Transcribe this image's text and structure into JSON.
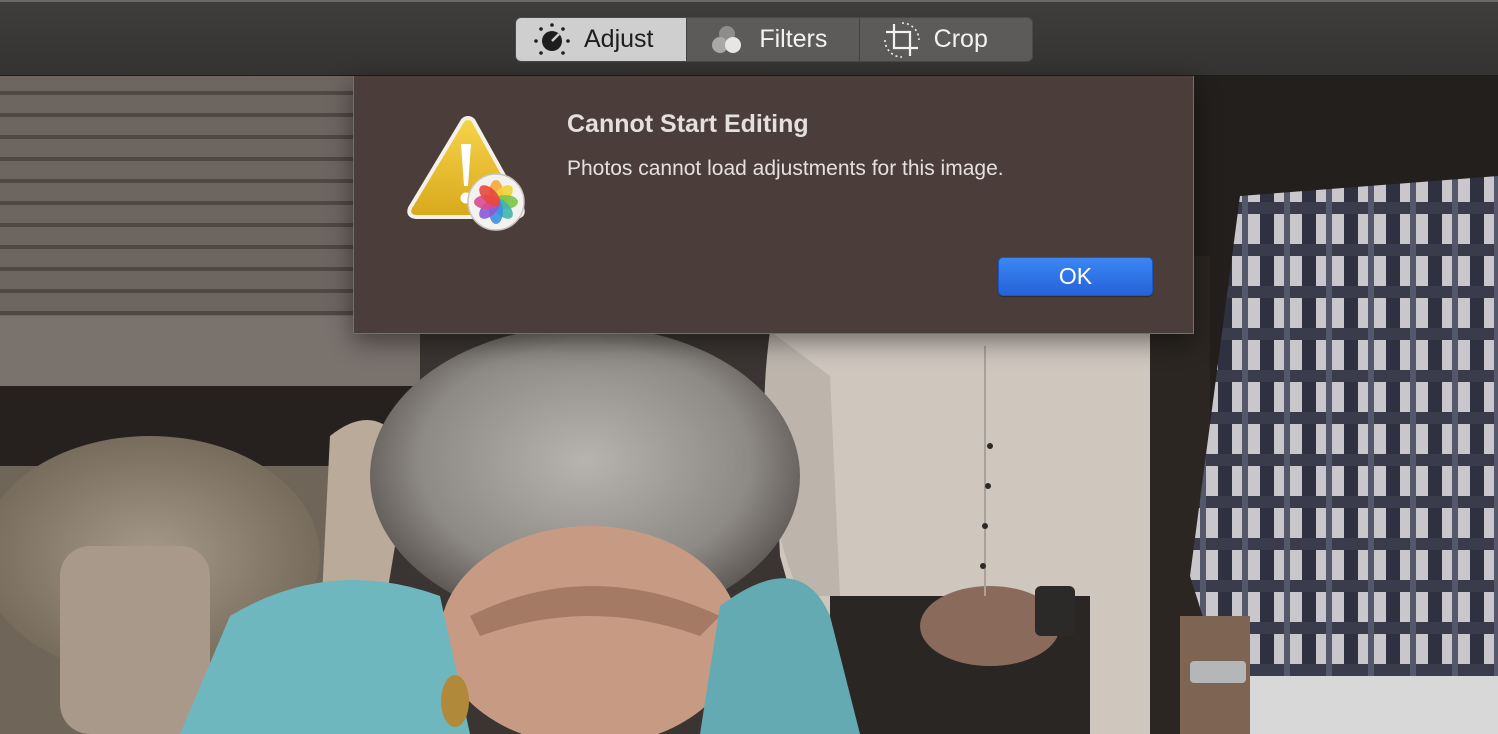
{
  "toolbar": {
    "tabs": [
      {
        "label": "Adjust",
        "icon": "adjust-dial-icon",
        "selected": true
      },
      {
        "label": "Filters",
        "icon": "filters-circles-icon",
        "selected": false
      },
      {
        "label": "Crop",
        "icon": "crop-icon",
        "selected": false
      }
    ]
  },
  "alert": {
    "title": "Cannot Start Editing",
    "message": "Photos cannot load adjustments for this image.",
    "ok_label": "OK",
    "icon": "warning-photos-icon"
  },
  "colors": {
    "toolbar_bg": "#383736",
    "segment_selected": "#cfcfcf",
    "sheet_bg": "#4b3e3a",
    "ok_button": "#2f72e6"
  }
}
